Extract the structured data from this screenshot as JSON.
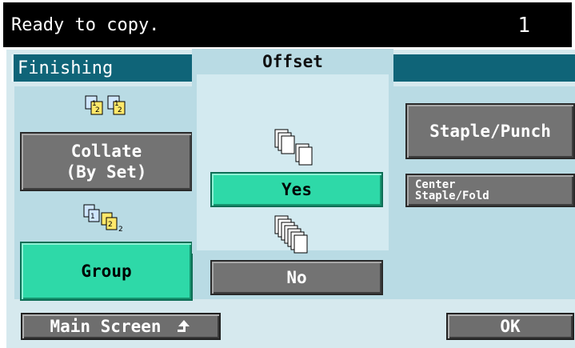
{
  "status": {
    "message": "Ready to copy.",
    "count": "1"
  },
  "header": {
    "title": "Finishing"
  },
  "finishing": {
    "collate_label": "Collate\n(By Set)",
    "group_label": "Group",
    "selected": "Group"
  },
  "offset": {
    "title": "Offset",
    "yes_label": "Yes",
    "no_label": "No",
    "selected": "Yes"
  },
  "side": {
    "staple_punch_label": "Staple/Punch",
    "center_staple_fold_label": "Center\nStaple/Fold"
  },
  "footer": {
    "main_screen_label": "Main Screen",
    "ok_label": "OK"
  },
  "colors": {
    "selected": "#2ed9a8",
    "unselected": "#737373",
    "header": "#0f6478",
    "panel": "#b9dbe4"
  }
}
